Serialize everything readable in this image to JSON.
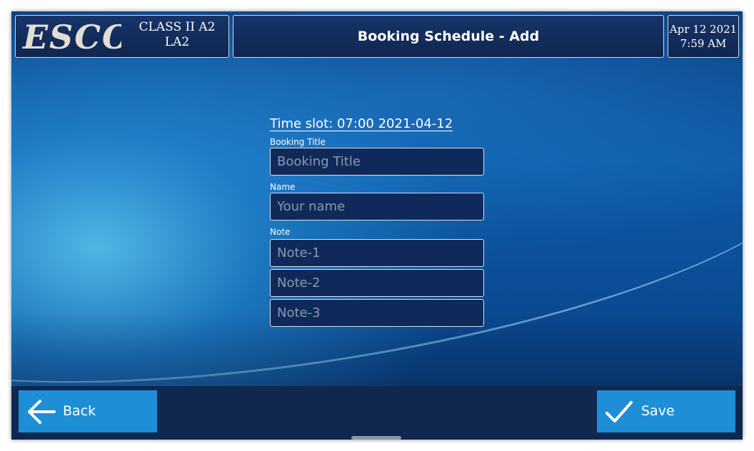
{
  "header": {
    "brand": "ESCO",
    "model_line1": "CLASS II A2",
    "model_line2": "LA2",
    "title": "Booking Schedule - Add",
    "date": "Apr 12 2021",
    "time": "7:59 AM"
  },
  "form": {
    "time_slot": "Time slot: 07:00 2021-04-12",
    "booking_title": {
      "label": "Booking Title",
      "placeholder": "Booking Title"
    },
    "name": {
      "label": "Name",
      "placeholder": "Your name"
    },
    "note": {
      "label": "Note",
      "placeholders": [
        "Note-1",
        "Note-2",
        "Note-3"
      ]
    }
  },
  "footer": {
    "back_label": "Back",
    "save_label": "Save"
  },
  "colors": {
    "header_bg": "#10284f",
    "button_bg": "#1e8fd6",
    "input_bg": "#0f2a5a",
    "placeholder_text": "#8c98ae"
  },
  "icons": [
    "arrow-left-icon",
    "checkmark-icon"
  ]
}
